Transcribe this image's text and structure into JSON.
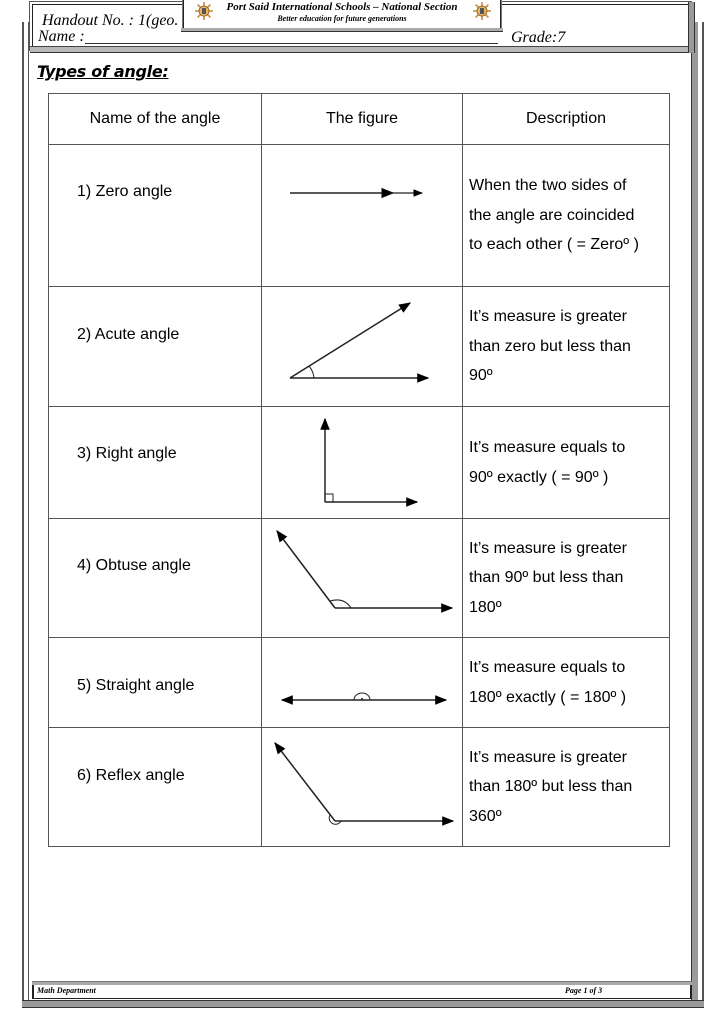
{
  "header": {
    "handout": "Handout No. : 1(geo.",
    "name_label": "Name :",
    "grade": "Grade:7",
    "school_name": "Port Said International Schools – National Section",
    "school_motto": "Better education for future generations"
  },
  "section_title": "Types of angle:",
  "table": {
    "columns": [
      "Name of the angle",
      "The figure",
      "Description"
    ],
    "rows": [
      {
        "name": "1) Zero angle",
        "figure": "zero-angle-figure",
        "description": [
          "When the two sides of",
          "the angle are coincided",
          "to each other   ( = Zeroº )"
        ]
      },
      {
        "name": "2) Acute angle",
        "figure": "acute-angle-figure",
        "description": [
          "It’s measure is greater",
          "than zero but less than",
          "90º"
        ]
      },
      {
        "name": "3) Right angle",
        "figure": "right-angle-figure",
        "description": [
          "It’s measure equals to",
          "90º exactly   ( = 90º )"
        ]
      },
      {
        "name": "4) Obtuse angle",
        "figure": "obtuse-angle-figure",
        "description": [
          "It’s measure is greater",
          "than 90º but less than",
          "180º"
        ]
      },
      {
        "name": "5) Straight angle",
        "figure": "straight-angle-figure",
        "description": [
          "It’s measure equals to",
          "180º exactly  ( = 180º )"
        ]
      },
      {
        "name": "6) Reflex angle",
        "figure": "reflex-angle-figure",
        "description": [
          "It’s measure is greater",
          "than 180º but less than",
          "360º"
        ]
      }
    ]
  },
  "footer": {
    "department": "Math Department",
    "page": "Page 1 of 3"
  }
}
